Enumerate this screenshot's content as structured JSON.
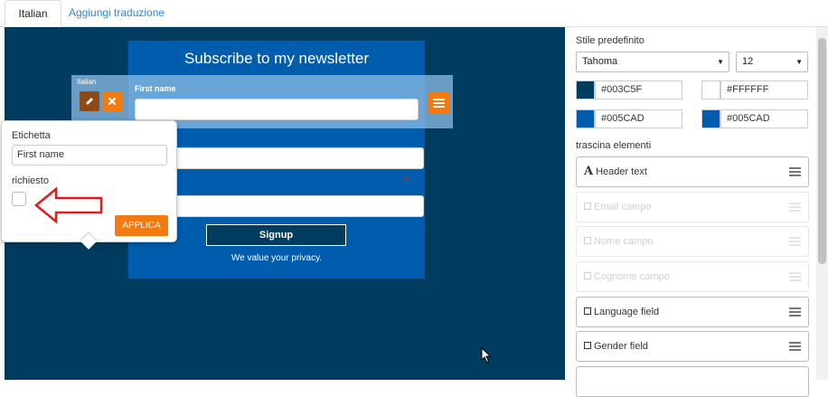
{
  "tabs": [
    {
      "label": "Italian",
      "active": true
    },
    {
      "label": "Aggiungi traduzione",
      "active": false
    }
  ],
  "form": {
    "title": "Subscribe to my newsletter",
    "row_language": "Italian",
    "field_label": "First name",
    "signup_label": "Signup",
    "privacy_text": "We value your privacy.",
    "required_marker": "*"
  },
  "popover": {
    "label_caption": "Etichetta",
    "label_value": "First name",
    "required_caption": "richiesto",
    "apply_label": "APPLICA"
  },
  "panel": {
    "style_title": "Stile predefinito",
    "font_value": "Tahoma",
    "size_value": "12",
    "colors": [
      "#003C5F",
      "#FFFFFF",
      "#005CAD",
      "#005CAD"
    ],
    "drag_title": "trascina elementi",
    "items": [
      {
        "label": "Header text",
        "enabled": true
      },
      {
        "label": "Email campo",
        "enabled": false
      },
      {
        "label": "Nome campo",
        "enabled": false
      },
      {
        "label": "Cognome campo",
        "enabled": false
      },
      {
        "label": "Language field",
        "enabled": true
      },
      {
        "label": "Gender field",
        "enabled": true
      }
    ]
  },
  "theme": {
    "canvas_bg": "#003c5f",
    "form_bg": "#005cad",
    "accent_orange": "#f27a10",
    "edit_brown": "#8b4a16",
    "link_blue": "#2a8ad8"
  }
}
